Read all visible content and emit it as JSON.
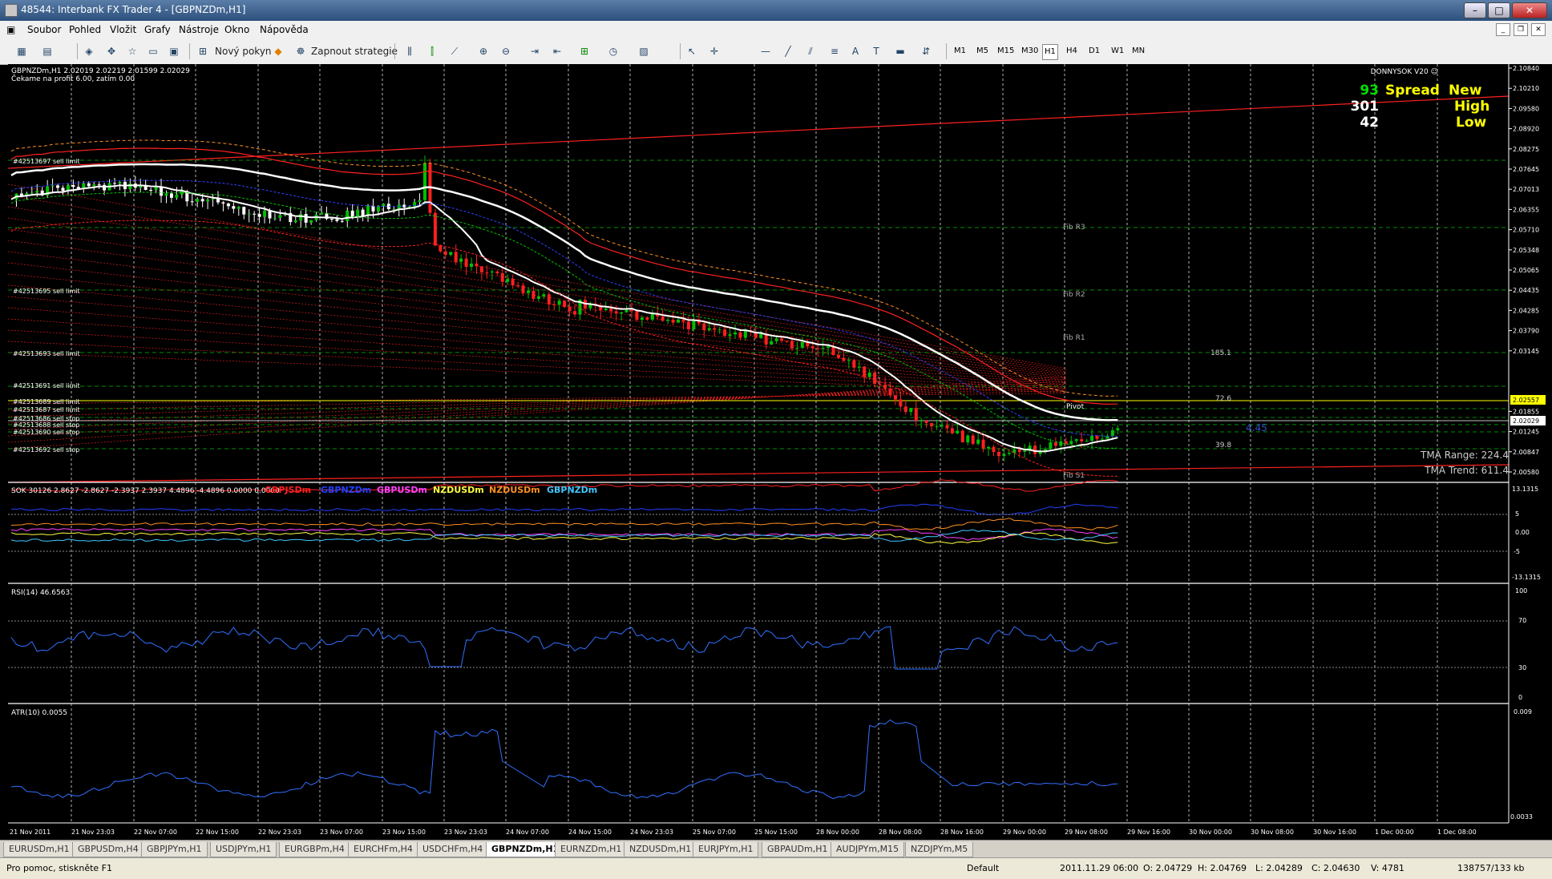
{
  "window": {
    "title": "48544: Interbank FX Trader 4 - [GBPNZDm,H1]"
  },
  "menu": [
    "Soubor",
    "Pohled",
    "Vložit",
    "Grafy",
    "Nástroje",
    "Okno",
    "Nápověda"
  ],
  "toolbar": {
    "new_order": "Nový pokyn",
    "strategies": "Zapnout strategie",
    "timeframes": [
      "M1",
      "M5",
      "M15",
      "M30",
      "H1",
      "H4",
      "D1",
      "W1",
      "MN"
    ],
    "active_timeframe": "H1"
  },
  "chart": {
    "header": "GBPNZDm,H1  2.02019 2.02219 2.01599 2.02029",
    "waiting": "Čekame na profit 6.00, zatím 0.00",
    "brand": "DONNYSOK V20 ☺",
    "info": {
      "spread": "93",
      "spread_label": "Spread",
      "new_label": "New",
      "high_val": "301",
      "high_label": "High",
      "low_val": "42",
      "low_label": "Low"
    },
    "tma_range": "TMA Range: 224.4",
    "tma_trend": "TMA Trend: 611.4",
    "orders": [
      "#42513697 sell limit",
      "#42513695 sell limit",
      "#42513693 sell limit",
      "#42513691 sell limit",
      "#42513689 sell limit",
      "#42513687 sell limit",
      "#42513686 sell stop",
      "#42513688 sell stop",
      "#42513690 sell stop",
      "#42513692 sell stop"
    ],
    "fib": [
      "Fib R3",
      "Fib R2",
      "Fib R1",
      "Pivot",
      "Fib S1"
    ],
    "marks": [
      "185.1",
      "72.6",
      "39.8",
      "4.45"
    ],
    "price_axis": [
      "2.10840",
      "2.10210",
      "2.09580",
      "2.08920",
      "2.08275",
      "2.07645",
      "2.07013",
      "2.06355",
      "2.05710",
      "2.05348",
      "2.05065",
      "2.04435",
      "2.04285",
      "2.03790",
      "2.03145",
      "2.02557",
      "2.02029",
      "2.01855",
      "2.01245",
      "2.00847",
      "2.00580"
    ],
    "current_price": "2.02029",
    "ask_price": "2.02557",
    "time_axis": [
      "21 Nov 2011",
      "21 Nov 23:03",
      "22 Nov 07:00",
      "22 Nov 15:00",
      "22 Nov 23:03",
      "23 Nov 07:00",
      "23 Nov 15:00",
      "23 Nov 23:03",
      "24 Nov 07:00",
      "24 Nov 15:00",
      "24 Nov 23:03",
      "25 Nov 07:00",
      "25 Nov 15:00",
      "28 Nov 00:00",
      "28 Nov 08:00",
      "28 Nov 16:00",
      "29 Nov 00:00",
      "29 Nov 08:00",
      "29 Nov 16:00",
      "30 Nov 00:00",
      "30 Nov 08:00",
      "30 Nov 16:00",
      "1 Dec 00:00",
      "1 Dec 08:00"
    ]
  },
  "sok": {
    "header": "SOK 30126 2.8627 -2.8627 -2.3937 2.3937 4.4896 -4.4896 0.0000 0.0000",
    "legend": [
      {
        "name": "GBPJSDm",
        "color": "#ff2020"
      },
      {
        "name": "GBPNZDm",
        "color": "#2040ff"
      },
      {
        "name": "GBPUSDm",
        "color": "#ff40ff"
      },
      {
        "name": "NZDUSDm",
        "color": "#ffff40"
      },
      {
        "name": "NZDUSDm",
        "color": "#ff9020"
      },
      {
        "name": "GBPNZDm",
        "color": "#40c8ff"
      }
    ],
    "axis": [
      "13.1315",
      "5",
      "0.00",
      "-5",
      "-13.1315"
    ]
  },
  "rsi": {
    "header": "RSI(14) 46.6563",
    "axis": [
      "100",
      "70",
      "30",
      "0"
    ]
  },
  "atr": {
    "header": "ATR(10) 0.0055",
    "axis": [
      "0.009",
      "0.0033"
    ]
  },
  "tabs": [
    "EURUSDm,H1",
    "GBPUSDm,H4",
    "GBPJPYm,H1",
    "USDJPYm,H1",
    "EURGBPm,H4",
    "EURCHFm,H4",
    "USDCHFm,H4",
    "GBPNZDm,H1",
    "EURNZDm,H1",
    "NZDUSDm,H1",
    "EURJPYm,H1",
    "GBPAUDm,H1",
    "AUDJPYm,M15",
    "NZDJPYm,M5"
  ],
  "active_tab": "GBPNZDm,H1",
  "status": {
    "help": "Pro pomoc, stiskněte F1",
    "profile": "Default",
    "datetime": "2011.11.29 06:00",
    "open": "O: 2.04729",
    "high": "H: 2.04769",
    "low": "L: 2.04289",
    "close": "C: 2.04630",
    "volume": "V: 4781",
    "traffic": "138757/133 kb"
  },
  "colors": {
    "bull": "#00c000",
    "bear": "#ff2020",
    "grid": "#ffffff",
    "rsi": "#3070ff",
    "atr": "#3070ff"
  }
}
